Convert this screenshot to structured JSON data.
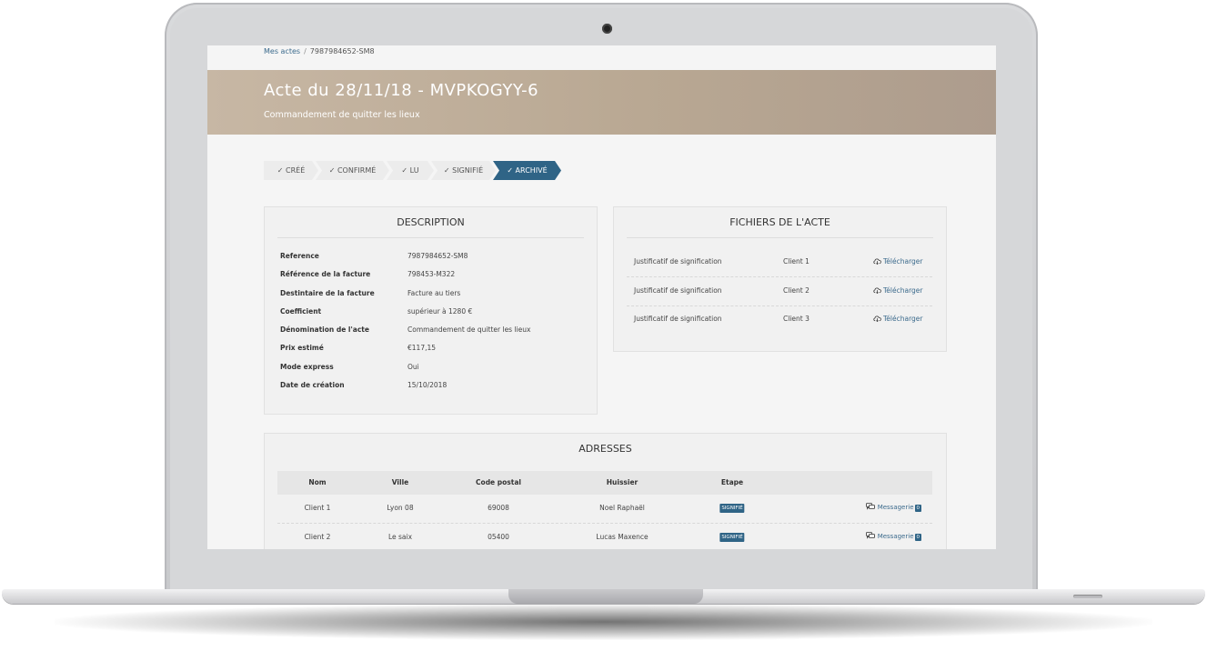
{
  "breadcrumb": {
    "link": "Mes actes",
    "separator": "/",
    "current": "7987984652-SM8"
  },
  "header": {
    "title": "Acte du 28/11/18 - MVPKOGYY-6",
    "subtitle": "Commandement de quitter les lieux"
  },
  "steps": [
    {
      "label": "✓ CRÉÉ",
      "active": false
    },
    {
      "label": "✓ CONFIRMÉ",
      "active": false
    },
    {
      "label": "✓ LU",
      "active": false
    },
    {
      "label": "✓ SIGNIFIÉ",
      "active": false
    },
    {
      "label": "✓ ARCHIVÉ",
      "active": true
    }
  ],
  "description": {
    "title": "DESCRIPTION",
    "fields": [
      {
        "label": "Reference",
        "value": "7987984652-SM8"
      },
      {
        "label": "Référence de la facture",
        "value": "798453-M322"
      },
      {
        "label": "Destintaire de la facture",
        "value": "Facture au tiers"
      },
      {
        "label": "Coefficient",
        "value": "supérieur à 1280 €"
      },
      {
        "label": "Dénomination de l'acte",
        "value": "Commandement de quitter les lieux"
      },
      {
        "label": "Prix estimé",
        "value": "€117,15"
      },
      {
        "label": "Mode express",
        "value": "Oui"
      },
      {
        "label": "Date de création",
        "value": "15/10/2018"
      }
    ]
  },
  "files": {
    "title": "FICHIERS DE L'ACTE",
    "download_label": "Télécharger",
    "rows": [
      {
        "name": "Justificatif de signification",
        "client": "Client 1"
      },
      {
        "name": "Justificatif de signification",
        "client": "Client 2"
      },
      {
        "name": "Justificatif de signification",
        "client": "Client 3"
      }
    ]
  },
  "addresses": {
    "title": "ADRESSES",
    "columns": [
      "Nom",
      "Ville",
      "Code postal",
      "Huissier",
      "Etape"
    ],
    "messaging_label": "Messagerie",
    "rows": [
      {
        "nom": "Client 1",
        "ville": "Lyon 08",
        "code_postal": "69008",
        "huissier": "Noel Raphaël",
        "etape": "SIGNIFIÉ",
        "messages": "0"
      },
      {
        "nom": "Client 2",
        "ville": "Le saix",
        "code_postal": "05400",
        "huissier": "Lucas Maxence",
        "etape": "SIGNIFIÉ",
        "messages": "0"
      }
    ]
  },
  "colors": {
    "accent": "#2f6486",
    "hero_start": "#c7b7a4",
    "hero_end": "#ad9c8d",
    "link": "#3b6a8c"
  },
  "icons": {
    "download": "cloud-download-icon",
    "messaging": "chat-bubbles-icon"
  }
}
